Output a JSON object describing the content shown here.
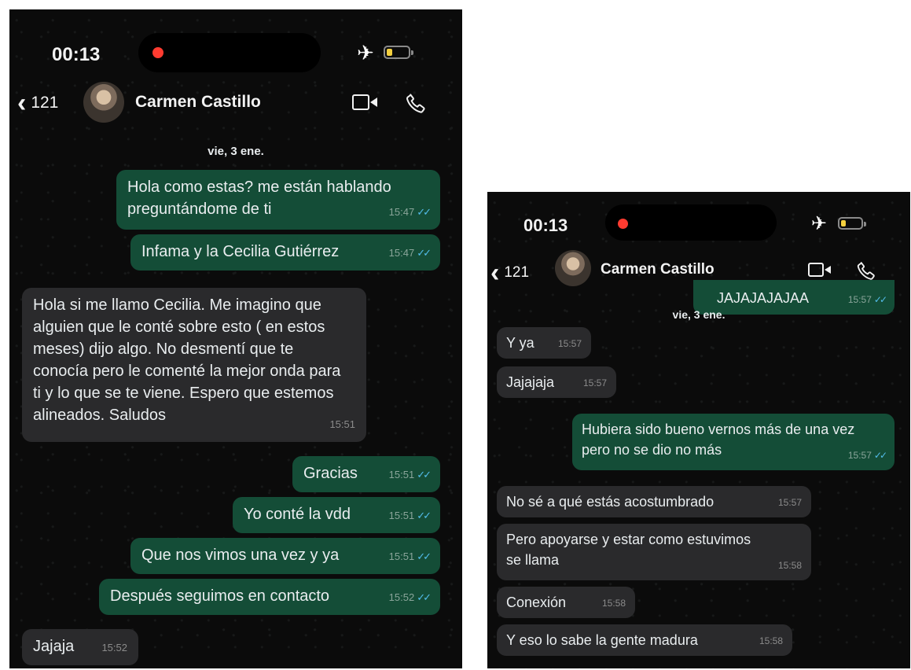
{
  "screenshots": [
    {
      "status": {
        "time": "00:13"
      },
      "header": {
        "back_count": "121",
        "contact_name": "Carmen Castillo"
      },
      "date_label": "vie, 3 ene.",
      "messages": [
        {
          "dir": "out",
          "text": "Hola como estas? me están hablando preguntándome de ti",
          "time": "15:47",
          "read": true
        },
        {
          "dir": "out",
          "text": "Infama y la Cecilia Gutiérrez",
          "time": "15:47",
          "read": true
        },
        {
          "dir": "in",
          "text": "Hola si me llamo Cecilia. Me imagino que alguien que le conté sobre esto ( en estos meses) dijo algo. No desmentí que te conocía pero le comenté la mejor onda para ti y lo que se te viene. Espero que estemos alineados. Saludos",
          "time": "15:51"
        },
        {
          "dir": "out",
          "text": "Gracias",
          "time": "15:51",
          "read": true
        },
        {
          "dir": "out",
          "text": "Yo conté la vdd",
          "time": "15:51",
          "read": true
        },
        {
          "dir": "out",
          "text": "Que nos vimos una vez y ya",
          "time": "15:51",
          "read": true
        },
        {
          "dir": "out",
          "text": "Después seguimos en contacto",
          "time": "15:52",
          "read": true
        },
        {
          "dir": "in",
          "text": "Jajaja",
          "time": "15:52"
        }
      ]
    },
    {
      "status": {
        "time": "00:13"
      },
      "header": {
        "back_count": "121",
        "contact_name": "Carmen Castillo"
      },
      "date_label": "vie, 3 ene.",
      "messages": [
        {
          "dir": "out",
          "text": "JAJAJAJAJAA",
          "time": "15:57",
          "read": true
        },
        {
          "dir": "in",
          "text": "Y ya",
          "time": "15:57"
        },
        {
          "dir": "in",
          "text": "Jajajaja",
          "time": "15:57"
        },
        {
          "dir": "out",
          "text": "Hubiera sido bueno vernos más de una vez pero no se dio no más",
          "time": "15:57",
          "read": true
        },
        {
          "dir": "in",
          "text": "No sé a qué estás acostumbrado",
          "time": "15:57"
        },
        {
          "dir": "in",
          "text": "Pero apoyarse y estar como estuvimos se llama",
          "time": "15:58"
        },
        {
          "dir": "in",
          "text": "Conexión",
          "time": "15:58"
        },
        {
          "dir": "in",
          "text": "Y eso lo sabe la gente madura",
          "time": "15:58"
        }
      ]
    }
  ],
  "icons": {
    "back": "chevron-left-icon",
    "video": "video-camera-icon",
    "call": "phone-icon",
    "airplane": "airplane-mode-icon",
    "battery": "battery-low-icon",
    "read_receipt": "double-check-icon"
  },
  "colors": {
    "background": "#0b0b0b",
    "outgoing_bubble": "#144d37",
    "incoming_bubble": "#2a2a2c",
    "read_ticks": "#53bdeb",
    "recording_dot": "#ff3b30",
    "battery_fill": "#f4d03f"
  }
}
